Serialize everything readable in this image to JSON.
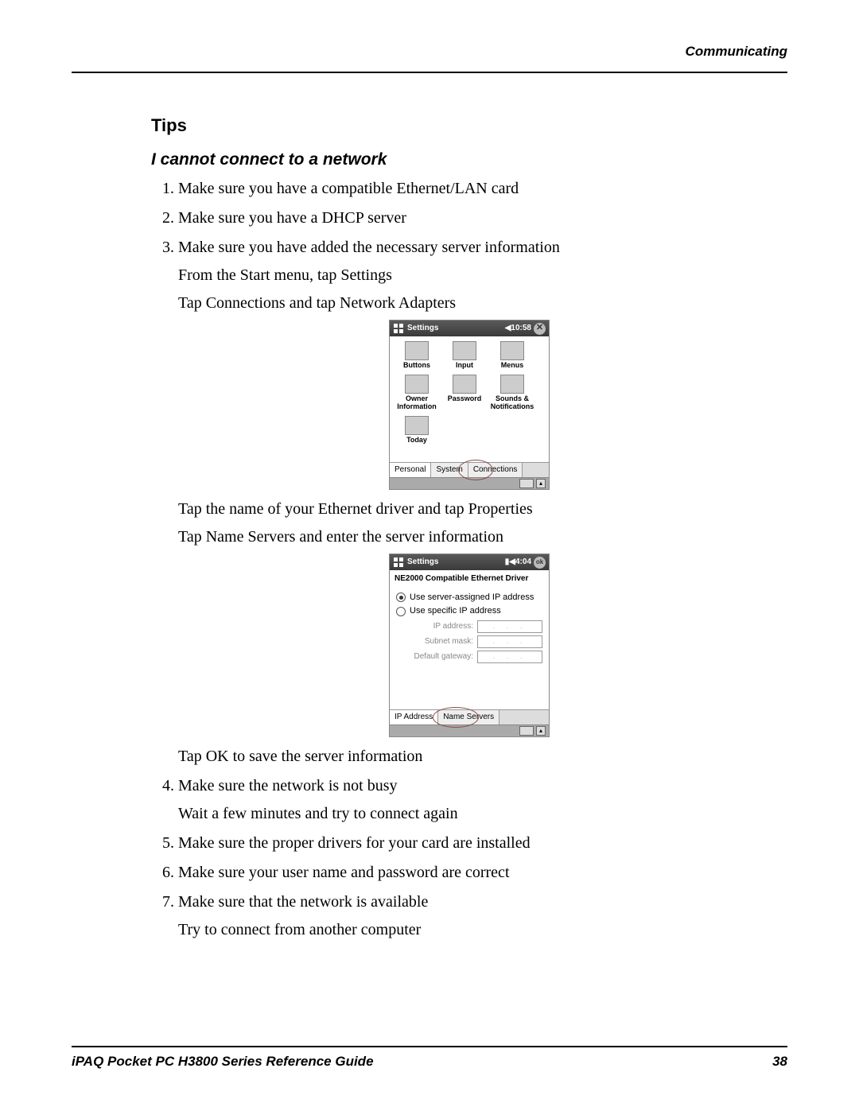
{
  "header": {
    "running": "Communicating"
  },
  "section": {
    "tips_heading": "Tips",
    "subheading": "I cannot connect to a network"
  },
  "steps": [
    {
      "text": "Make sure you have a compatible Ethernet/LAN card"
    },
    {
      "text": "Make sure you have a DHCP server"
    },
    {
      "text": "Make sure you have added the necessary server information",
      "cont": [
        "From the Start menu, tap Settings",
        "Tap Connections and tap Network Adapters"
      ],
      "after_screenshot1": [
        "Tap the name of your Ethernet driver and tap Properties",
        "Tap Name Servers and enter the server information"
      ],
      "after_screenshot2": [
        "Tap OK to save the server information"
      ]
    },
    {
      "text": "Make sure the network is not busy",
      "cont": [
        "Wait a few minutes and try to connect again"
      ]
    },
    {
      "text": "Make sure the proper drivers for your card are installed"
    },
    {
      "text": "Make sure your user name and password are correct"
    },
    {
      "text": "Make sure that the network is available",
      "cont": [
        "Try to connect from another computer"
      ]
    }
  ],
  "screenshot1": {
    "title": "Settings",
    "time": "10:58",
    "speaker_label": "◀",
    "close_glyph": "✕",
    "icons": [
      {
        "label": "Buttons"
      },
      {
        "label": "Input"
      },
      {
        "label": "Menus"
      },
      {
        "label": "Owner Information"
      },
      {
        "label": "Password"
      },
      {
        "label": "Sounds & Notifications"
      },
      {
        "label": "Today"
      }
    ],
    "tabs": [
      "Personal",
      "System",
      "Connections"
    ],
    "circled_tab_index": 2
  },
  "screenshot2": {
    "title": "Settings",
    "time": "4:04",
    "ok_label": "ok",
    "panel_title": "NE2000 Compatible Ethernet Driver",
    "radios": [
      {
        "label": "Use server-assigned IP address",
        "selected": true
      },
      {
        "label": "Use specific IP address",
        "selected": false
      }
    ],
    "fields": [
      {
        "label": "IP address:",
        "value": ". . ."
      },
      {
        "label": "Subnet mask:",
        "value": ". . ."
      },
      {
        "label": "Default gateway:",
        "value": ". . ."
      }
    ],
    "tabs": [
      "IP Address",
      "Name Servers"
    ],
    "circled_tab_index": 1
  },
  "footer": {
    "guide": "iPAQ Pocket PC H3800 Series Reference Guide",
    "page": "38"
  }
}
